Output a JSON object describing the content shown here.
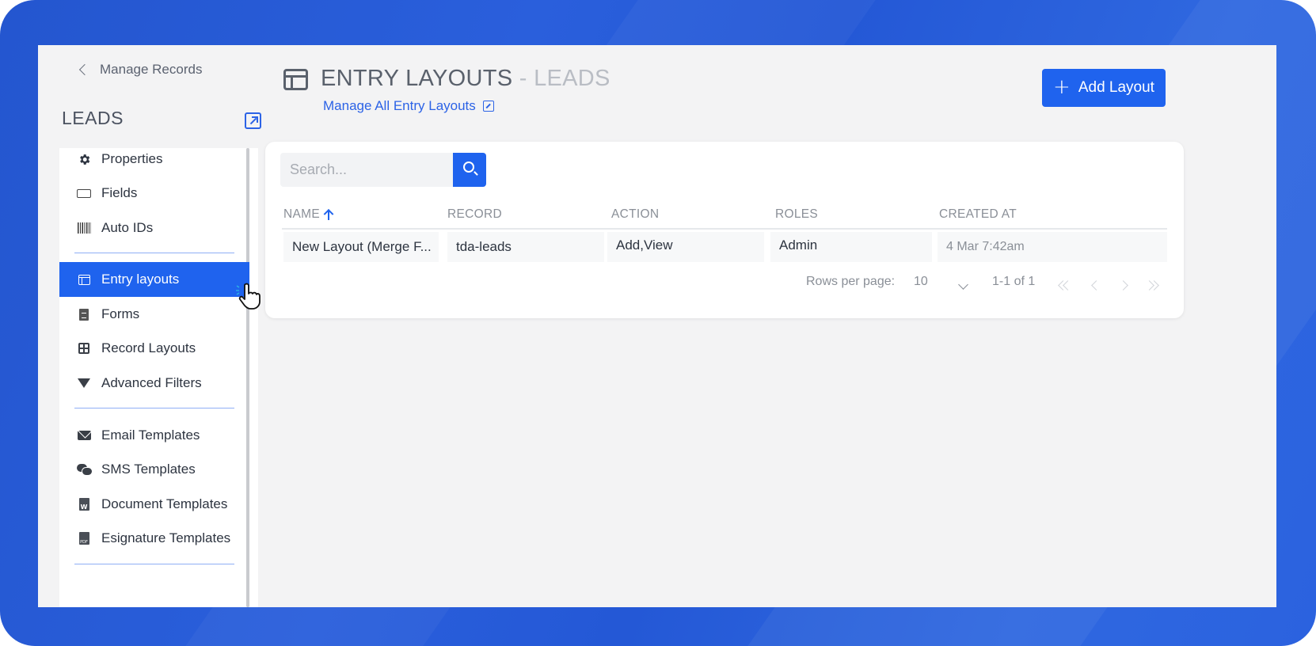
{
  "sidebar": {
    "back_label": "Manage Records",
    "title": "LEADS",
    "items": [
      {
        "label": "Properties",
        "icon": "gear-icon"
      },
      {
        "label": "Fields",
        "icon": "field-icon"
      },
      {
        "label": "Auto IDs",
        "icon": "barcode-icon"
      },
      {
        "label": "Entry layouts",
        "icon": "layout-icon",
        "active": true
      },
      {
        "label": "Forms",
        "icon": "document-icon"
      },
      {
        "label": "Record Layouts",
        "icon": "grid-icon"
      },
      {
        "label": "Advanced Filters",
        "icon": "filter-icon"
      },
      {
        "label": "Email Templates",
        "icon": "mail-icon"
      },
      {
        "label": "SMS Templates",
        "icon": "chat-icon"
      },
      {
        "label": "Document Templates",
        "icon": "word-doc-icon"
      },
      {
        "label": "Esignature Templates",
        "icon": "pdf-icon"
      }
    ]
  },
  "header": {
    "title_main": "ENTRY LAYOUTS",
    "title_sub": " - LEADS",
    "manage_all_label": "Manage All Entry Layouts",
    "add_button_label": "Add Layout"
  },
  "search": {
    "placeholder": "Search..."
  },
  "table": {
    "columns": [
      "NAME",
      "RECORD",
      "ACTION",
      "ROLES",
      "CREATED AT"
    ],
    "sorted_column": "NAME",
    "sort_direction": "ascending",
    "rows": [
      {
        "name": "New Layout (Merge F...",
        "record": "tda-leads",
        "action": "Add,View",
        "roles": "Admin",
        "created_at": "4 Mar  7:42am"
      }
    ]
  },
  "pagination": {
    "rows_per_page_label": "Rows per page:",
    "rows_per_page_value": "10",
    "range_label": "1-1 of 1"
  },
  "colors": {
    "accent": "#1f63ee",
    "frame": "#2a5fdc"
  }
}
